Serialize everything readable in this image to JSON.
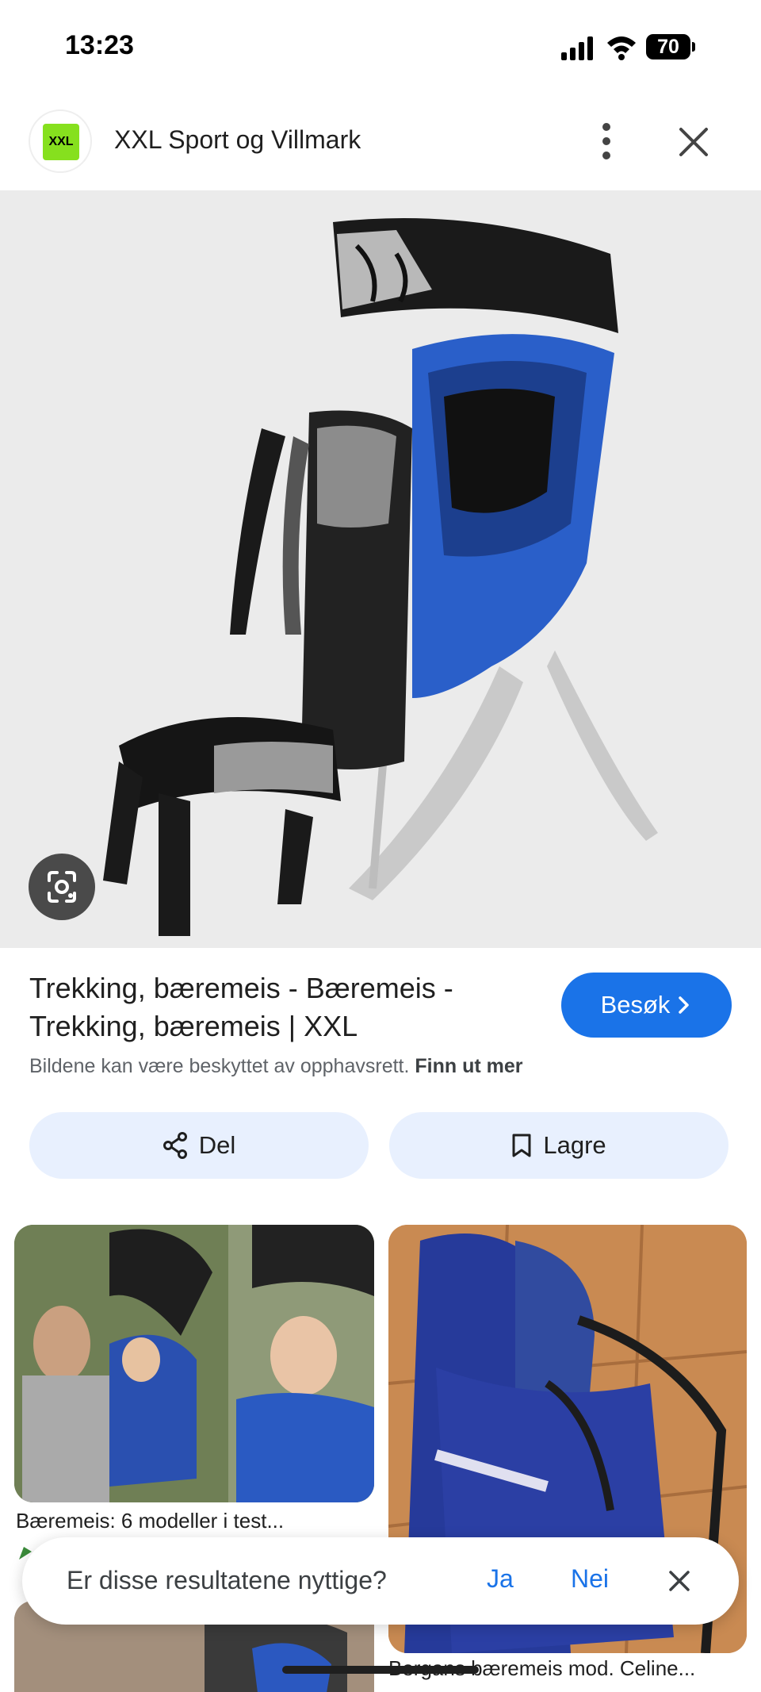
{
  "status": {
    "time": "13:23",
    "battery": "70"
  },
  "header": {
    "site_name": "XXL Sport og Villmark",
    "logo_text": "XXL"
  },
  "result": {
    "title": "Trekking, bæremeis - Bæremeis - Trekking, bæremeis | XXL",
    "visit_label": "Besøk",
    "copyright": "Bildene kan være beskyttet av opphavsrett.",
    "learn_more": "Finn ut mer"
  },
  "actions": {
    "share_label": "Del",
    "save_label": "Lagre"
  },
  "related": [
    {
      "caption": "Bæremeis: 6 modeller i test..."
    },
    {
      "caption": "Bergans bæremeis mod. Celine..."
    }
  ],
  "feedback": {
    "question": "Er disse resultatene nyttige?",
    "yes": "Ja",
    "no": "Nei"
  },
  "colors": {
    "accent": "#1a73e8",
    "chip_bg": "#e8f0fe",
    "hero_bg": "#ebebeb",
    "brand": "#86e01e"
  }
}
